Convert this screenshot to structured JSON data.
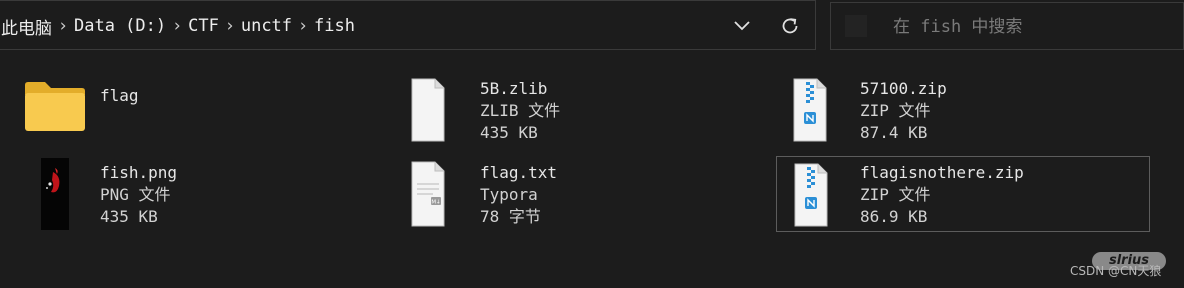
{
  "address_bar": {
    "crumbs": [
      "此电脑",
      "Data (D:)",
      "CTF",
      "unctf",
      "fish"
    ],
    "separator": "›"
  },
  "search": {
    "placeholder": "在 fish 中搜索"
  },
  "files": [
    {
      "name": "flag",
      "type": "",
      "size": "",
      "icon": "folder-icon"
    },
    {
      "name": "5B.zlib",
      "type": "ZLIB 文件",
      "size": "435 KB",
      "icon": "generic-file-icon"
    },
    {
      "name": "57100.zip",
      "type": "ZIP 文件",
      "size": "87.4 KB",
      "icon": "zip-file-icon"
    },
    {
      "name": "fish.png",
      "type": "PNG 文件",
      "size": "435 KB",
      "icon": "image-thumbnail"
    },
    {
      "name": "flag.txt",
      "type": "Typora",
      "size": "78 字节",
      "icon": "markdown-file-icon"
    },
    {
      "name": "flagisnothere.zip",
      "type": "ZIP 文件",
      "size": "86.9 KB",
      "icon": "zip-file-icon"
    }
  ],
  "watermark": {
    "logo": "slrius",
    "text": "CSDN @CN天狼"
  },
  "colors": {
    "background": "#1c1c1c",
    "folder": "#f7c948",
    "zip_accent": "#2b8fd6"
  }
}
